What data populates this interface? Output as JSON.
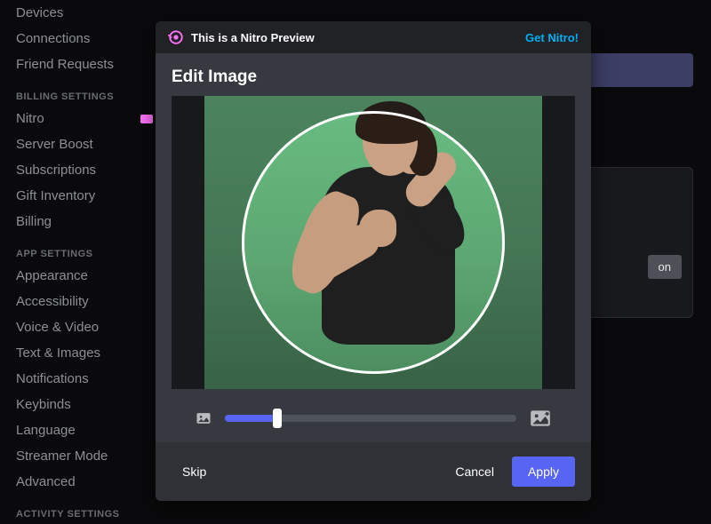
{
  "sidebar": {
    "user_settings_items": [
      {
        "label": "Devices"
      },
      {
        "label": "Connections"
      },
      {
        "label": "Friend Requests"
      }
    ],
    "billing_header": "BILLING SETTINGS",
    "billing_items": [
      {
        "label": "Nitro",
        "badge": true
      },
      {
        "label": "Server Boost"
      },
      {
        "label": "Subscriptions"
      },
      {
        "label": "Gift Inventory"
      },
      {
        "label": "Billing"
      }
    ],
    "app_header": "APP SETTINGS",
    "app_items": [
      {
        "label": "Appearance"
      },
      {
        "label": "Accessibility"
      },
      {
        "label": "Voice & Video"
      },
      {
        "label": "Text & Images"
      },
      {
        "label": "Notifications"
      },
      {
        "label": "Keybinds"
      },
      {
        "label": "Language"
      },
      {
        "label": "Streamer Mode"
      },
      {
        "label": "Advanced"
      }
    ],
    "activity_header": "ACTIVITY SETTINGS"
  },
  "background_panel": {
    "partial_button_text": "on"
  },
  "modal": {
    "banner": {
      "icon": "nitro-icon",
      "text": "This is a Nitro Preview",
      "link": "Get Nitro!"
    },
    "title": "Edit Image",
    "zoom": {
      "min_icon": "image-small-icon",
      "max_icon": "image-large-icon",
      "value_pct": 18
    },
    "footer": {
      "skip": "Skip",
      "cancel": "Cancel",
      "apply": "Apply"
    }
  },
  "colors": {
    "brand": "#5865f2",
    "link": "#00aff4",
    "nitro_pink": "#ff73fa"
  }
}
